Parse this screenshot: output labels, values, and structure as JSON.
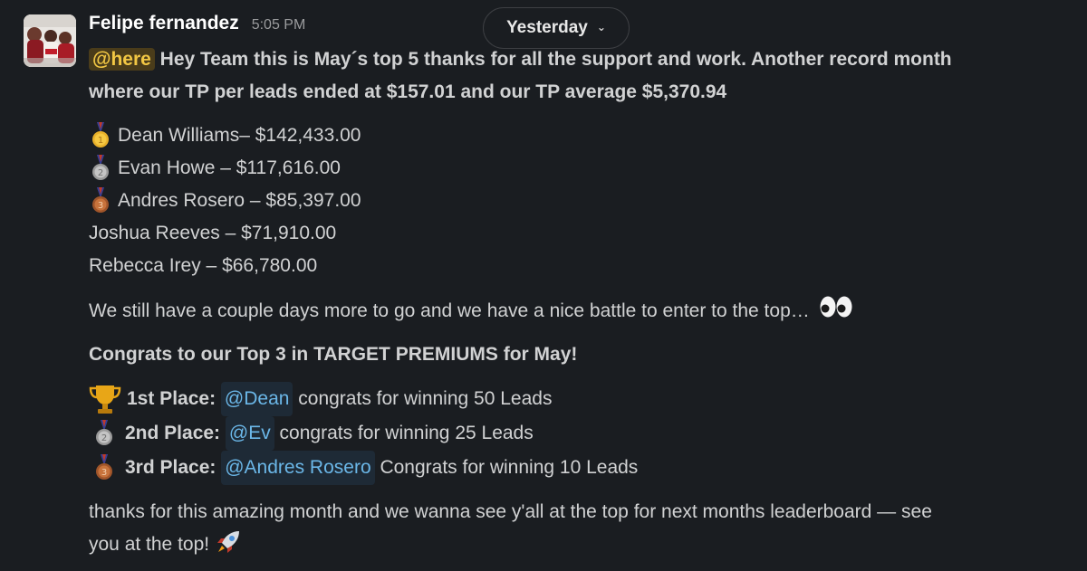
{
  "message": {
    "sender": "Felipe fernandez",
    "timestamp": "5:05 PM",
    "date_divider": "Yesterday",
    "intro_mention": "@here",
    "intro_text_1": " Hey Team this is May´s top 5 thanks for all the support and work. Another record month",
    "intro_text_2": "where our TP per leads ended at $157.01 and our TP average $5,370.94",
    "leaderboard": [
      {
        "text": "Dean Williams– $142,433.00",
        "medal": "gold-medal-icon"
      },
      {
        "text": " Evan Howe – $117,616.00",
        "medal": "silver-medal-icon"
      },
      {
        "text": " Andres Rosero – $85,397.00",
        "medal": "bronze-medal-icon"
      },
      {
        "text": "Joshua Reeves – $71,910.00",
        "medal": ""
      },
      {
        "text": "Rebecca Irey – $66,780.00",
        "medal": ""
      }
    ],
    "battle_text": "We still have a couple days more to go and we have a nice battle to enter to the top…",
    "congrats_heading": "Congrats to our Top 3 in TARGET PREMIUMS for May!",
    "places": [
      {
        "place": "1st Place:",
        "mention": "@Dean",
        "text": " congrats for winning 50 Leads",
        "icon": "trophy-icon"
      },
      {
        "place": "2nd Place:",
        "mention": "@Ev",
        "text": " congrats for winning 25 Leads",
        "icon": "silver-medal-icon"
      },
      {
        "place": "3rd Place:",
        "mention": "@Andres Rosero",
        "text": " Congrats for winning 10 Leads",
        "icon": "bronze-medal-icon"
      }
    ],
    "closing_1": "thanks for this amazing month and we wanna see y'all at the top for next months leaderboard — see",
    "closing_2": "you at the top! "
  },
  "colors": {
    "background": "#1a1d21",
    "text": "#d1d2d3",
    "here_mention_bg": "#4a3c1a",
    "here_mention_fg": "#f2c744",
    "user_mention_bg": "#1e2a36",
    "user_mention_fg": "#6bb7e8"
  }
}
